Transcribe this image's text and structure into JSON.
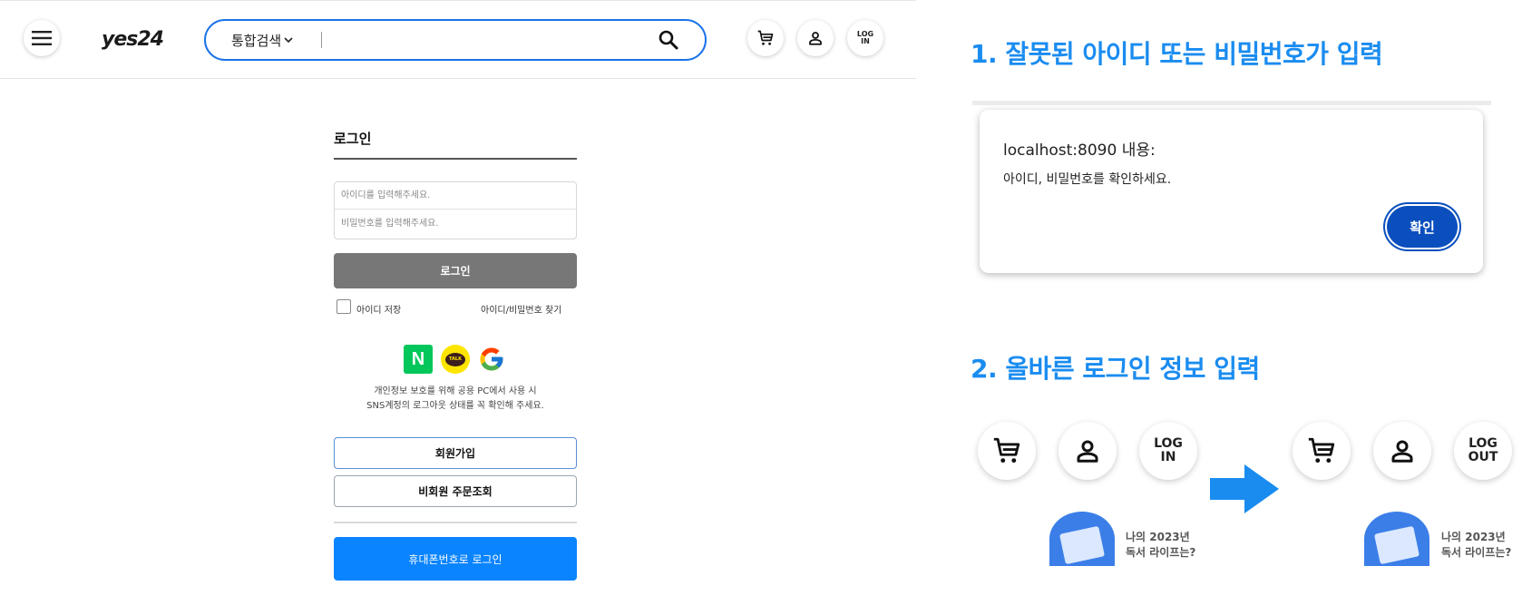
{
  "header": {
    "logo_text": "yes24",
    "search": {
      "category_label": "통합검색",
      "placeholder": "",
      "value": ""
    },
    "login_label_line1": "LOG",
    "login_label_line2": "IN"
  },
  "login": {
    "title": "로그인",
    "id_placeholder": "아이디를 입력해주세요.",
    "pw_placeholder": "비밀번호를 입력해주세요.",
    "login_button": "로그인",
    "save_id": "아이디 저장",
    "find_link": "아이디/비밀번호 찾기",
    "sns": {
      "naver": "N",
      "kakao": "TALK",
      "google": "G"
    },
    "notice_line1": "개인정보 보호를 위해 공용 PC에서 사용 시",
    "notice_line2": "SNS계정의 로그아웃 상태를 꼭 확인해 주세요.",
    "signup_button": "회원가입",
    "guest_order_button": "비회원 주문조회",
    "phone_login_button": "휴대폰번호로 로그인"
  },
  "section1": {
    "heading": "1. 잘못된 아이디 또는 비밀번호가 입력",
    "dialog": {
      "origin": "localhost:8090 내용:",
      "message": "아이디, 비밀번호를 확인하세요.",
      "ok_button": "확인"
    }
  },
  "section2": {
    "heading": "2. 올바른 로그인 정보 입력",
    "before": {
      "login_line1": "LOG",
      "login_line2": "IN",
      "promo_line1": "나의 2023년",
      "promo_line2": "독서 라이프는?"
    },
    "after": {
      "login_line1": "LOG",
      "login_line2": "OUT",
      "promo_line1": "나의 2023년",
      "promo_line2": "독서 라이프는?"
    }
  },
  "colors": {
    "accent_blue": "#1a8cf0",
    "search_border": "#1a73e8",
    "login_gray": "#777777",
    "phone_blue": "#0a84ff",
    "dialog_ok": "#0b4fbe",
    "naver_green": "#03c75a",
    "kakao_yellow": "#fee500"
  }
}
